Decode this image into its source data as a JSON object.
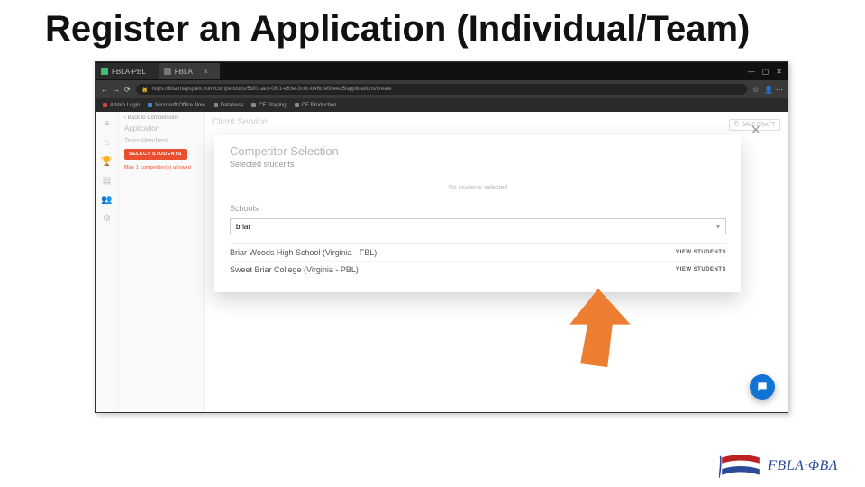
{
  "slide": {
    "title": "Register an Application (Individual/Team)"
  },
  "browser": {
    "tabs": [
      {
        "label": "FBLA-PBL"
      },
      {
        "label": "FBLA"
      }
    ],
    "url": "https://fbla.mapspark.com/competitions/5bf01ae1-08f1-e83e-3c0c-b46cfe0beea5/applications/create",
    "bookmarks": [
      "Admin Login",
      "Microsoft Office Now",
      "Database",
      "CE Staging",
      "CE Production"
    ],
    "window_controls": [
      "—",
      "▢",
      "✕"
    ]
  },
  "sidebar": {
    "back": "‹  Back to Competitions",
    "application_label": "Application",
    "team_label": "Team Members",
    "select_button": "SELECT STUDENTS",
    "competitor_limit": "Max 1 competitor(s) allowed"
  },
  "page": {
    "bg_title": "Client Service",
    "save_draft": "SAVE DRAFT"
  },
  "dialog": {
    "title": "Competitor Selection",
    "subtitle": "Selected students",
    "empty_text": "No students selected",
    "schools_label": "Schools",
    "search_value": "briar",
    "results": [
      {
        "name": "Briar Woods High School (Virginia - FBL)",
        "action": "VIEW STUDENTS"
      },
      {
        "name": "Sweet Briar College (Virginia - PBL)",
        "action": "VIEW STUDENTS"
      }
    ]
  },
  "logo": {
    "text": "FBLA·ΦBΛ"
  }
}
